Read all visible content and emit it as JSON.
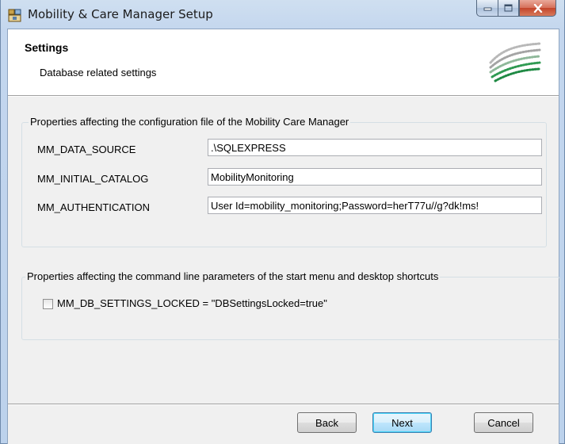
{
  "window": {
    "title": "Mobility & Care Manager Setup"
  },
  "banner": {
    "title": "Settings",
    "subtitle": "Database related settings"
  },
  "config_group": {
    "legend": "Properties affecting the configuration file of the Mobility  Care Manager",
    "properties": [
      {
        "label": "MM_DATA_SOURCE",
        "value": ".\\SQLEXPRESS"
      },
      {
        "label": "MM_INITIAL_CATALOG",
        "value": "MobilityMonitoring"
      },
      {
        "label": "MM_AUTHENTICATION",
        "value": "User Id=mobility_monitoring;Password=herT77u//g?dk!ms!"
      }
    ]
  },
  "cmdline_group": {
    "legend": "Properties affecting the command line parameters of the start menu and desktop shortcuts",
    "checkbox_label": "MM_DB_SETTINGS_LOCKED = \"DBSettingsLocked=true\"",
    "checked": false
  },
  "buttons": {
    "back": "Back",
    "next": "Next",
    "cancel": "Cancel"
  },
  "icons": {
    "app": "installer-icon",
    "minimize": "minimize-icon",
    "maximize": "maximize-icon",
    "close": "close-icon",
    "logo": "brand-wave-logo"
  }
}
